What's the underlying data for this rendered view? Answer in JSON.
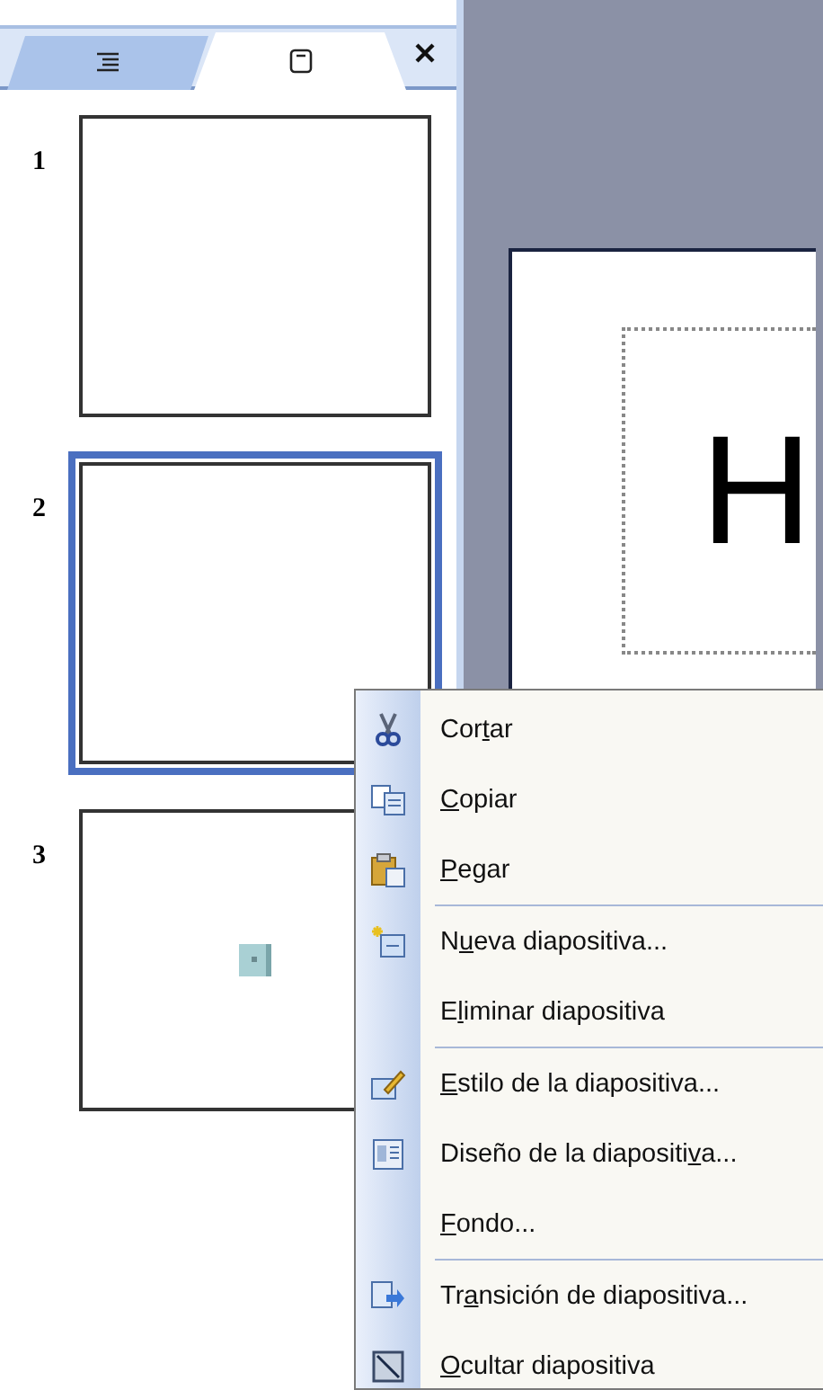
{
  "pane": {
    "tabs": [
      {
        "kind": "outline",
        "selected": false
      },
      {
        "kind": "slides",
        "selected": true
      }
    ],
    "slides": [
      {
        "number": "1",
        "selected": false,
        "kind": "blank"
      },
      {
        "number": "2",
        "selected": true,
        "kind": "blank"
      },
      {
        "number": "3",
        "selected": false,
        "kind": "object"
      }
    ]
  },
  "editor": {
    "title_text": "H"
  },
  "context_menu": {
    "items": [
      {
        "kind": "cut",
        "pre": "Cor",
        "key": "t",
        "post": "ar"
      },
      {
        "kind": "copy",
        "key": "C",
        "post": "opiar"
      },
      {
        "kind": "paste",
        "key": "P",
        "post": "egar"
      },
      {
        "kind": "separator"
      },
      {
        "kind": "newslide",
        "pre": "N",
        "key": "u",
        "post": "eva diapositiva..."
      },
      {
        "kind": "plain",
        "pre": "E",
        "key": "l",
        "post": "iminar diapositiva"
      },
      {
        "kind": "separator"
      },
      {
        "kind": "style",
        "key": "E",
        "post": "stilo de la diapositiva..."
      },
      {
        "kind": "layout",
        "pre": "Diseño de la diapositi",
        "key": "v",
        "post": "a..."
      },
      {
        "kind": "plain",
        "key": "F",
        "post": "ondo..."
      },
      {
        "kind": "separator"
      },
      {
        "kind": "transition",
        "pre": "Tr",
        "key": "a",
        "post": "nsición de diapositiva..."
      },
      {
        "kind": "hide",
        "key": "O",
        "post": "cultar diapositiva"
      }
    ]
  }
}
